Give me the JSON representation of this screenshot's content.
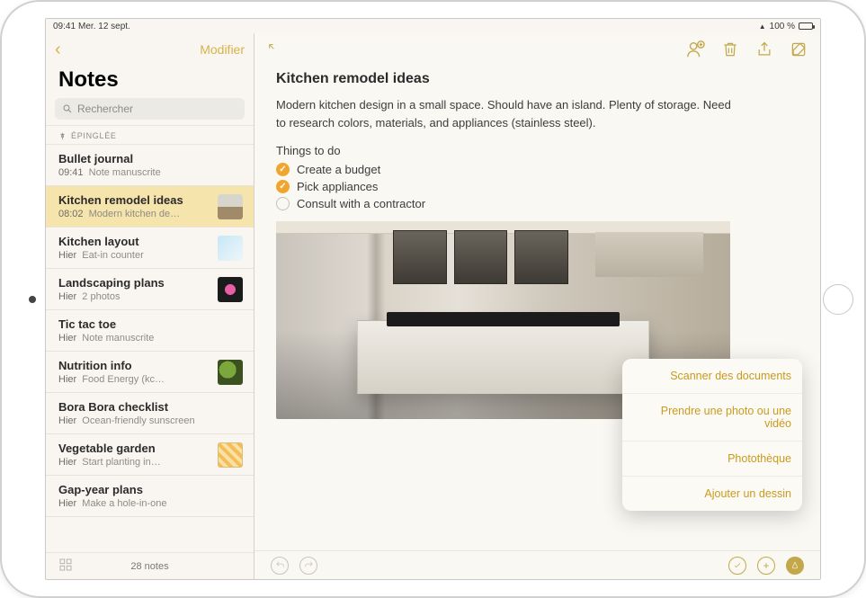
{
  "statusbar": {
    "time": "09:41",
    "date": "Mer. 12 sept.",
    "battery_text": "100 %"
  },
  "sidebar": {
    "edit_label": "Modifier",
    "title": "Notes",
    "search_placeholder": "Rechercher",
    "pinned_label": "ÉPINGLÉE",
    "notes": [
      {
        "title": "Bullet journal",
        "time": "09:41",
        "subtitle": "Note manuscrite",
        "has_thumb": false
      },
      {
        "title": "Kitchen remodel ideas",
        "time": "08:02",
        "subtitle": "Modern kitchen de…",
        "has_thumb": true,
        "thumb": "kitchen",
        "selected": true
      },
      {
        "title": "Kitchen layout",
        "time": "Hier",
        "subtitle": "Eat-in counter",
        "has_thumb": true,
        "thumb": "layout"
      },
      {
        "title": "Landscaping plans",
        "time": "Hier",
        "subtitle": "2 photos",
        "has_thumb": true,
        "thumb": "flower"
      },
      {
        "title": "Tic tac toe",
        "time": "Hier",
        "subtitle": "Note manuscrite",
        "has_thumb": false
      },
      {
        "title": "Nutrition info",
        "time": "Hier",
        "subtitle": "Food Energy (kc…",
        "has_thumb": true,
        "thumb": "nutri"
      },
      {
        "title": "Bora Bora checklist",
        "time": "Hier",
        "subtitle": "Ocean-friendly sunscreen",
        "has_thumb": false
      },
      {
        "title": "Vegetable garden",
        "time": "Hier",
        "subtitle": "Start planting in…",
        "has_thumb": true,
        "thumb": "veg"
      },
      {
        "title": "Gap-year plans",
        "time": "Hier",
        "subtitle": "Make a hole-in-one",
        "has_thumb": false
      }
    ],
    "footer_count": "28 notes"
  },
  "note": {
    "heading": "Kitchen remodel ideas",
    "body": "Modern kitchen design in a small space. Should have an island. Plenty of storage. Need to research colors, materials, and appliances (stainless steel).",
    "subhead": "Things to do",
    "todos": [
      {
        "text": "Create a budget",
        "done": true
      },
      {
        "text": "Pick appliances",
        "done": true
      },
      {
        "text": "Consult with a contractor",
        "done": false
      }
    ]
  },
  "popover": {
    "items": [
      "Scanner des documents",
      "Prendre une photo ou une vidéo",
      "Photothèque",
      "Ajouter un dessin"
    ]
  },
  "colors": {
    "accent": "#c2a84a",
    "todo_done": "#f0a62e"
  }
}
